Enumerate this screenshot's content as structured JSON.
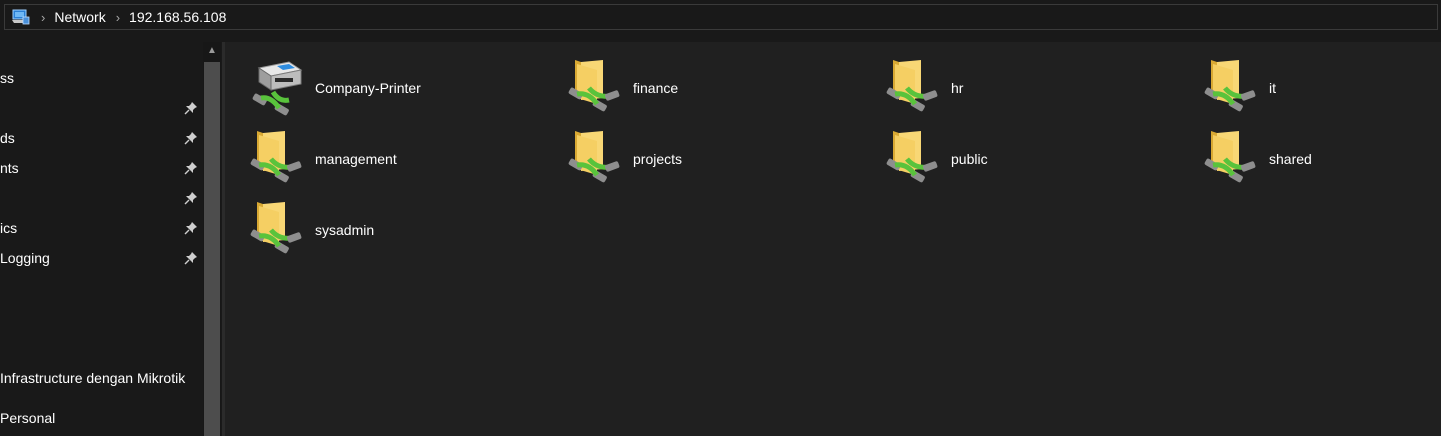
{
  "address_bar": {
    "crumbs": [
      "Network",
      "192.168.56.108"
    ]
  },
  "nav_pane": {
    "items": [
      {
        "label": "ss",
        "pinned": false
      },
      {
        "label": "",
        "pinned": true
      },
      {
        "label": "ds",
        "pinned": true
      },
      {
        "label": "nts",
        "pinned": true
      },
      {
        "label": "",
        "pinned": true
      },
      {
        "label": "ics",
        "pinned": true
      },
      {
        "label": "Logging",
        "pinned": true
      },
      {
        "label": "Infrastructure dengan Mikrotik",
        "pinned": false
      },
      {
        "label": " Personal",
        "pinned": false
      }
    ]
  },
  "content": {
    "items": [
      {
        "label": "Company-Printer",
        "icon": "network-printer-icon"
      },
      {
        "label": "finance",
        "icon": "network-share-folder-icon"
      },
      {
        "label": "hr",
        "icon": "network-share-folder-icon"
      },
      {
        "label": "it",
        "icon": "network-share-folder-icon"
      },
      {
        "label": "management",
        "icon": "network-share-folder-icon"
      },
      {
        "label": "projects",
        "icon": "network-share-folder-icon"
      },
      {
        "label": "public",
        "icon": "network-share-folder-icon"
      },
      {
        "label": "shared",
        "icon": "network-share-folder-icon"
      },
      {
        "label": "sysadmin",
        "icon": "network-share-folder-icon"
      }
    ]
  },
  "colors": {
    "background": "#191919",
    "content_background": "#202020",
    "folder_yellow": "#f5cf63",
    "network_green": "#59c33c"
  }
}
